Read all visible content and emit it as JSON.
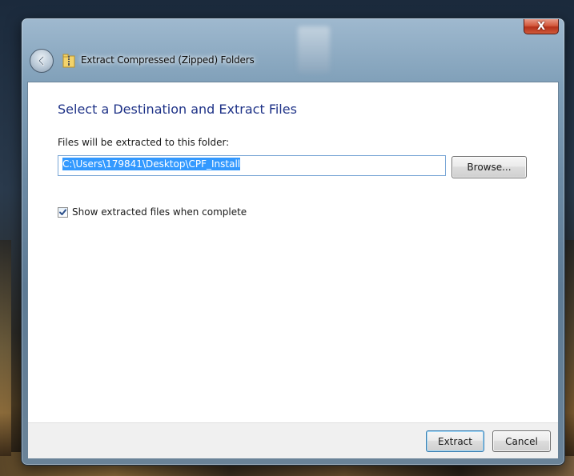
{
  "window": {
    "title": "Extract Compressed (Zipped) Folders",
    "close_label": "X"
  },
  "page": {
    "heading": "Select a Destination and Extract Files",
    "folder_label": "Files will be extracted to this folder:",
    "path_value": "C:\\Users\\179841\\Desktop\\CPF_Install",
    "browse_label": "Browse...",
    "show_files_label": "Show extracted files when complete",
    "show_files_checked": true
  },
  "footer": {
    "extract_label": "Extract",
    "cancel_label": "Cancel"
  },
  "icons": {
    "back": "back-arrow-icon",
    "title": "zip-folder-icon",
    "checkbox": "checkmark-icon"
  },
  "colors": {
    "heading": "#1e3287",
    "selection": "#3399ff",
    "close": "#c0392b"
  }
}
